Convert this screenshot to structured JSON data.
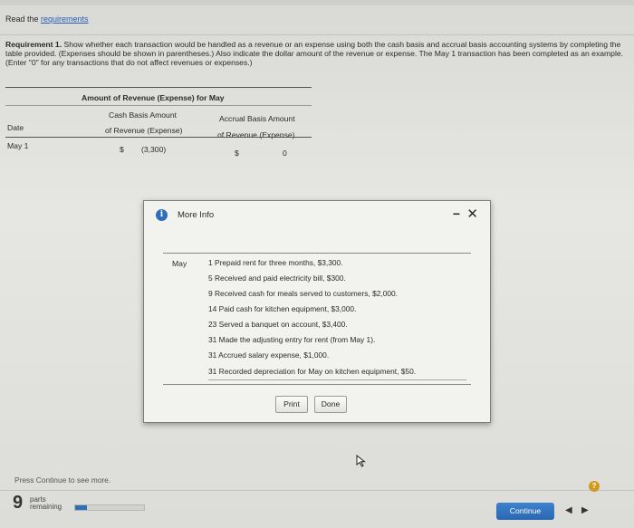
{
  "header": {
    "read_prefix": "Read the ",
    "requirements_link": "requirements"
  },
  "requirement": {
    "label": "Requirement 1.",
    "text": "Show whether each transaction would be handled as a revenue or an expense using both the cash basis and accrual basis accounting systems by completing the table provided. (Expenses should be shown in parentheses.) Also indicate the dollar amount of the revenue or expense. The May 1 transaction has been completed as an example. (Enter \"0\" for any transactions that do not affect revenues or expenses.)"
  },
  "table": {
    "title": "Amount of Revenue (Expense) for May",
    "col_cash_line1": "Cash Basis Amount",
    "col_cash_line2": "of Revenue (Expense)",
    "col_accrual_line1": "Accrual Basis Amount",
    "col_accrual_line2": "of Revenue (Expense)",
    "col_date": "Date",
    "rows": [
      {
        "date": "May 1",
        "cash_symbol": "$",
        "cash_value": "(3,300)",
        "accrual_symbol": "$",
        "accrual_value": "0"
      }
    ]
  },
  "modal": {
    "title": "More Info",
    "icon": "info-icon",
    "month": "May",
    "entries": [
      "1 Prepaid rent for three months, $3,300.",
      "5 Received and paid electricity bill, $300.",
      "9 Received cash for meals served to customers, $2,000.",
      "14 Paid cash for kitchen equipment, $3,000.",
      "23 Served a banquet on account, $3,400.",
      "31 Made the adjusting entry for rent (from May 1).",
      "31 Accrued salary expense, $1,000.",
      "31 Recorded depreciation for May on kitchen equipment, $50."
    ],
    "print_label": "Print",
    "done_label": "Done"
  },
  "footer": {
    "press_continue": "Press Continue to see more.",
    "parts_count": "9",
    "parts_word": "parts",
    "remaining_word": "remaining",
    "progress_fraction": 0.17,
    "continue_label": "Continue",
    "help_label": "?"
  },
  "colors": {
    "accent": "#2f6fb8",
    "help": "#d19a1e"
  }
}
